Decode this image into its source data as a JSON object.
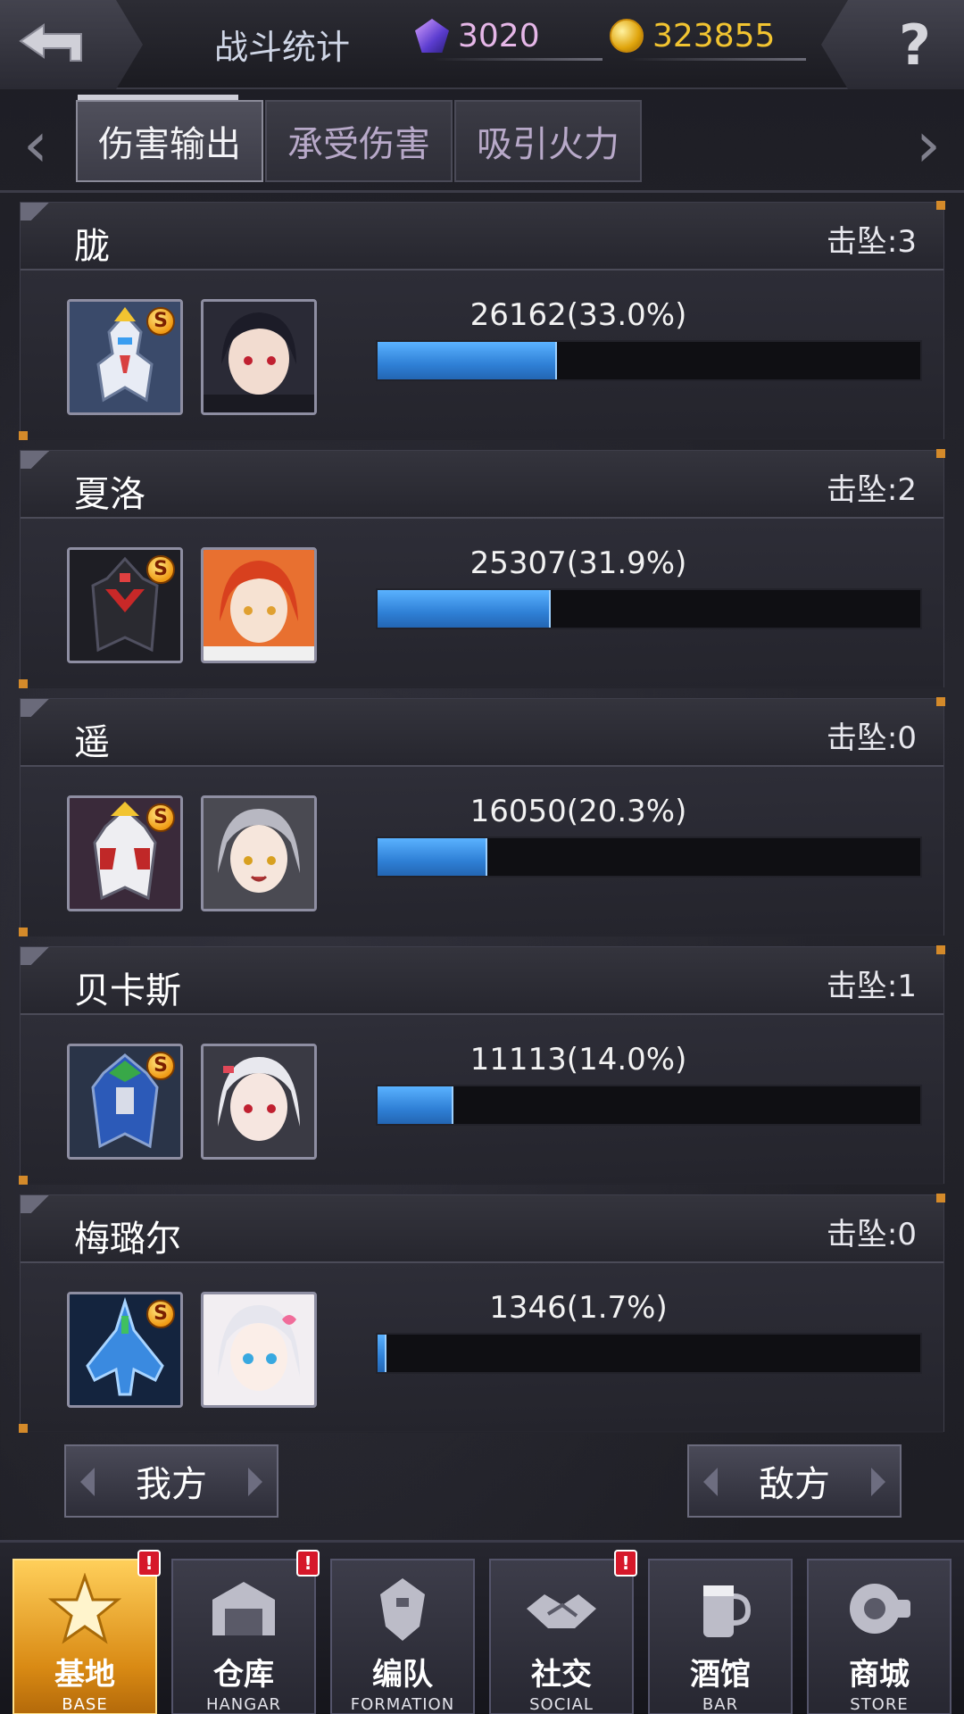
{
  "header": {
    "title": "战斗统计",
    "gems": "3020",
    "gold": "323855",
    "help_label": "?"
  },
  "tabs": [
    {
      "label": "伤害输出",
      "active": true
    },
    {
      "label": "承受伤害",
      "active": false
    },
    {
      "label": "吸引火力",
      "active": false
    }
  ],
  "arrows": {
    "left": "‹",
    "right": "›"
  },
  "players": [
    {
      "name": "胧",
      "kills": "击坠:3",
      "damage": "26162(33.0%)",
      "percent": 33.0
    },
    {
      "name": "夏洛",
      "kills": "击坠:2",
      "damage": "25307(31.9%)",
      "percent": 31.9
    },
    {
      "name": "遥",
      "kills": "击坠:0",
      "damage": "16050(20.3%)",
      "percent": 20.3
    },
    {
      "name": "贝卡斯",
      "kills": "击坠:1",
      "damage": "11113(14.0%)",
      "percent": 14.0
    },
    {
      "name": "梅璐尔",
      "kills": "击坠:0",
      "damage": "1346(1.7%)",
      "percent": 1.7
    }
  ],
  "side_buttons": {
    "mine": "我方",
    "enemy": "敌方"
  },
  "rank_badge": "S",
  "nav": [
    {
      "label": "基地",
      "sub": "BASE",
      "icon": "base-emblem-icon",
      "active": true,
      "alert": true
    },
    {
      "label": "仓库",
      "sub": "HANGAR",
      "icon": "hangar-icon",
      "active": false,
      "alert": true
    },
    {
      "label": "编队",
      "sub": "FORMATION",
      "icon": "formation-icon",
      "active": false,
      "alert": false
    },
    {
      "label": "社交",
      "sub": "SOCIAL",
      "icon": "handshake-icon",
      "active": false,
      "alert": true
    },
    {
      "label": "酒馆",
      "sub": "BAR",
      "icon": "bar-icon",
      "active": false,
      "alert": false
    },
    {
      "label": "商城",
      "sub": "STORE",
      "icon": "store-icon",
      "active": false,
      "alert": false
    }
  ],
  "alert_mark": "!"
}
